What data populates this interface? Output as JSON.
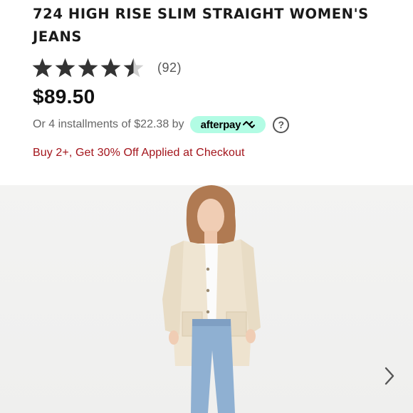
{
  "product": {
    "title": "724 HIGH RISE SLIM STRAIGHT WOMEN'S JEANS",
    "rating": 4.5,
    "rating_max": 5,
    "review_count": "(92)",
    "price": "$89.50"
  },
  "installments": {
    "text": "Or 4 installments of $22.38 by",
    "provider": "afterpay",
    "provider_icon": "afterpay-arrows-icon",
    "info_icon": "?"
  },
  "promo": {
    "text": "Buy 2+, Get 30% Off Applied at Checkout",
    "color": "#a3141b"
  },
  "gallery": {
    "image_alt": "product-photo",
    "next_icon": "chevron-right-icon"
  },
  "colors": {
    "afterpay_badge": "#b2fce4",
    "star_fill": "#333333",
    "star_empty": "#d0d0d0"
  }
}
